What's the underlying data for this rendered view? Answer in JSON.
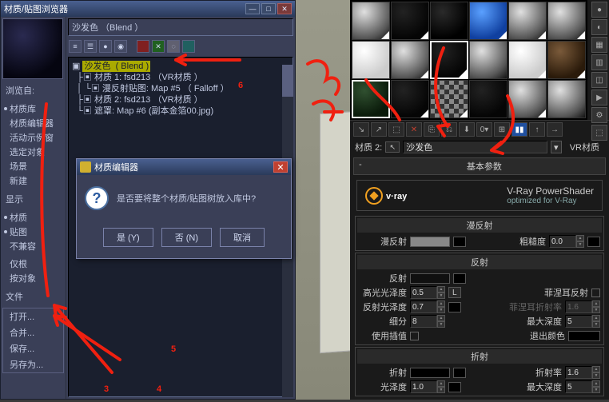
{
  "browser": {
    "title": "材质/贴图浏览器",
    "top_label": "沙发色 （Blend ）",
    "tree": {
      "root": "沙发色  ( Blend )",
      "items": [
        "材质 1: fsd213 （VR材质 ）",
        "漫反射贴图: Map #5 （ Falloff ）",
        "材质 2: fsd213 （VR材质 ）",
        "遮罩: Map #6 (副本金箔00.jpg)"
      ]
    },
    "sidebar": {
      "browse_hdr": "浏览自:",
      "browse": [
        "材质库",
        "材质编辑器",
        "活动示例窗",
        "选定对象",
        "场景",
        "新建"
      ],
      "show_hdr": "显示",
      "show": [
        "材质",
        "贴图",
        "不兼容"
      ],
      "extra": [
        "仅根",
        "按对象"
      ],
      "file_hdr": "文件",
      "file": [
        "打开...",
        "合并...",
        "保存...",
        "另存为..."
      ]
    }
  },
  "modal": {
    "title": "材质编辑器",
    "msg": "是否要将整个材质/贴图树放入库中?",
    "yes": "是 (Y)",
    "no": "否 (N)",
    "cancel": "取消"
  },
  "mat": {
    "name_label": "材质 2:",
    "name_value": "沙发色",
    "type": "VR材质",
    "rollout_basic": "基本参数",
    "vray": {
      "brand": "v·ray",
      "tagline1": "V-Ray PowerShader",
      "tagline2": "optimized for V-Ray"
    },
    "diffuse": {
      "hdr": "漫反射",
      "label": "漫反射",
      "rough_label": "粗糙度",
      "rough": "0.0"
    },
    "reflect": {
      "hdr": "反射",
      "label": "反射",
      "hg_label": "高光光泽度",
      "hg": "0.5",
      "L": "L",
      "rg_label": "反射光泽度",
      "rg": "0.7",
      "sub_label": "细分",
      "sub": "8",
      "interp_label": "使用插值",
      "fres_label": "菲涅耳反射",
      "fresior_label": "菲涅耳折射率",
      "fresior": "1.6",
      "depth_label": "最大深度",
      "depth": "5",
      "exit_label": "退出颜色"
    },
    "refract": {
      "hdr": "折射",
      "label": "折射",
      "ior_label": "折射率",
      "ior": "1.6",
      "gloss_label": "光泽度",
      "gloss": "1.0",
      "depth_label": "最大深度",
      "depth": "5"
    }
  },
  "anno": {
    "n2": "2",
    "n3": "3",
    "n4": "4",
    "n5": "5",
    "n6": "6"
  }
}
